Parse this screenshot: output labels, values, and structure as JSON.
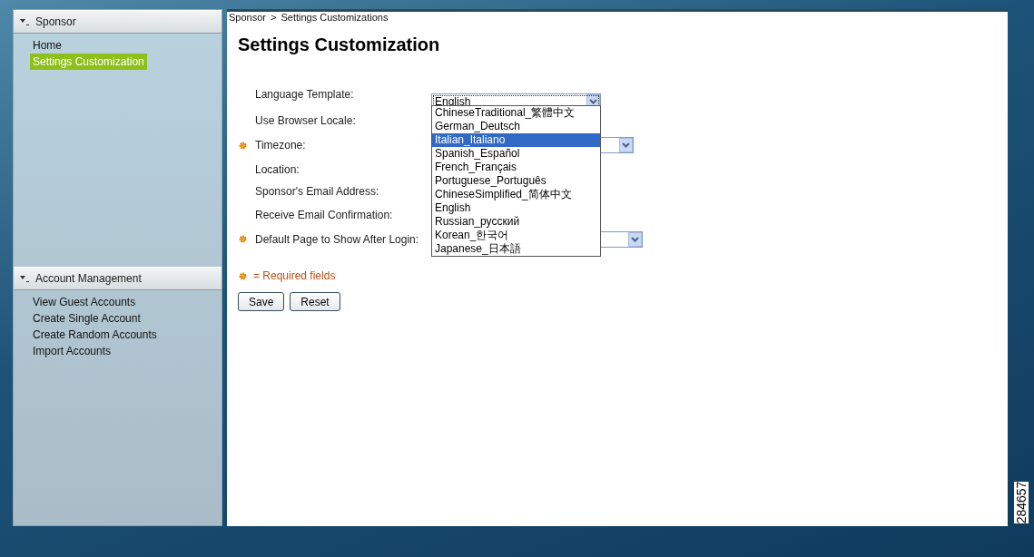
{
  "sidebar": {
    "sections": [
      {
        "title": "Sponsor",
        "expanded": true,
        "items": [
          {
            "label": "Home",
            "selected": false
          },
          {
            "label": "Settings Customization",
            "selected": true
          }
        ]
      },
      {
        "title": "Account Management",
        "expanded": true,
        "items": [
          {
            "label": "View Guest Accounts",
            "selected": false
          },
          {
            "label": "Create Single Account",
            "selected": false
          },
          {
            "label": "Create Random Accounts",
            "selected": false
          },
          {
            "label": "Import Accounts",
            "selected": false
          }
        ]
      }
    ]
  },
  "breadcrumb": {
    "items": [
      "Sponsor",
      "Settings Customizations"
    ],
    "separator": ">"
  },
  "page_title": "Settings Customization",
  "form": {
    "fields": [
      {
        "label": "Language Template:",
        "required": false,
        "kind": "select",
        "value": "English",
        "open": true
      },
      {
        "label": "Use Browser Locale:",
        "required": false,
        "kind": "none"
      },
      {
        "label": "Timezone:",
        "required": true,
        "kind": "select",
        "open": false
      },
      {
        "label": "Location:",
        "required": false,
        "kind": "none"
      },
      {
        "label": "Sponsor's Email Address:",
        "required": false,
        "kind": "none"
      },
      {
        "label": "Receive Email Confirmation:",
        "required": false,
        "kind": "none"
      },
      {
        "label": "Default Page to Show After Login:",
        "required": true,
        "kind": "select",
        "open": false
      }
    ]
  },
  "dropdown": {
    "options": [
      {
        "label": "ChineseTraditional_繁體中文",
        "selected": false
      },
      {
        "label": "German_Deutsch",
        "selected": false
      },
      {
        "label": "Italian_Italiano",
        "selected": true
      },
      {
        "label": "Spanish_Español",
        "selected": false
      },
      {
        "label": "French_Français",
        "selected": false
      },
      {
        "label": "Portuguese_Português",
        "selected": false
      },
      {
        "label": "ChineseSimplified_简体中文",
        "selected": false
      },
      {
        "label": "English",
        "selected": false
      },
      {
        "label": "Russian_русский",
        "selected": false
      },
      {
        "label": "Korean_한국어",
        "selected": false
      },
      {
        "label": "Japanese_日本語",
        "selected": false
      }
    ]
  },
  "required_note": "= Required fields",
  "buttons": [
    "Save",
    "Reset"
  ],
  "figure_number": "284657"
}
